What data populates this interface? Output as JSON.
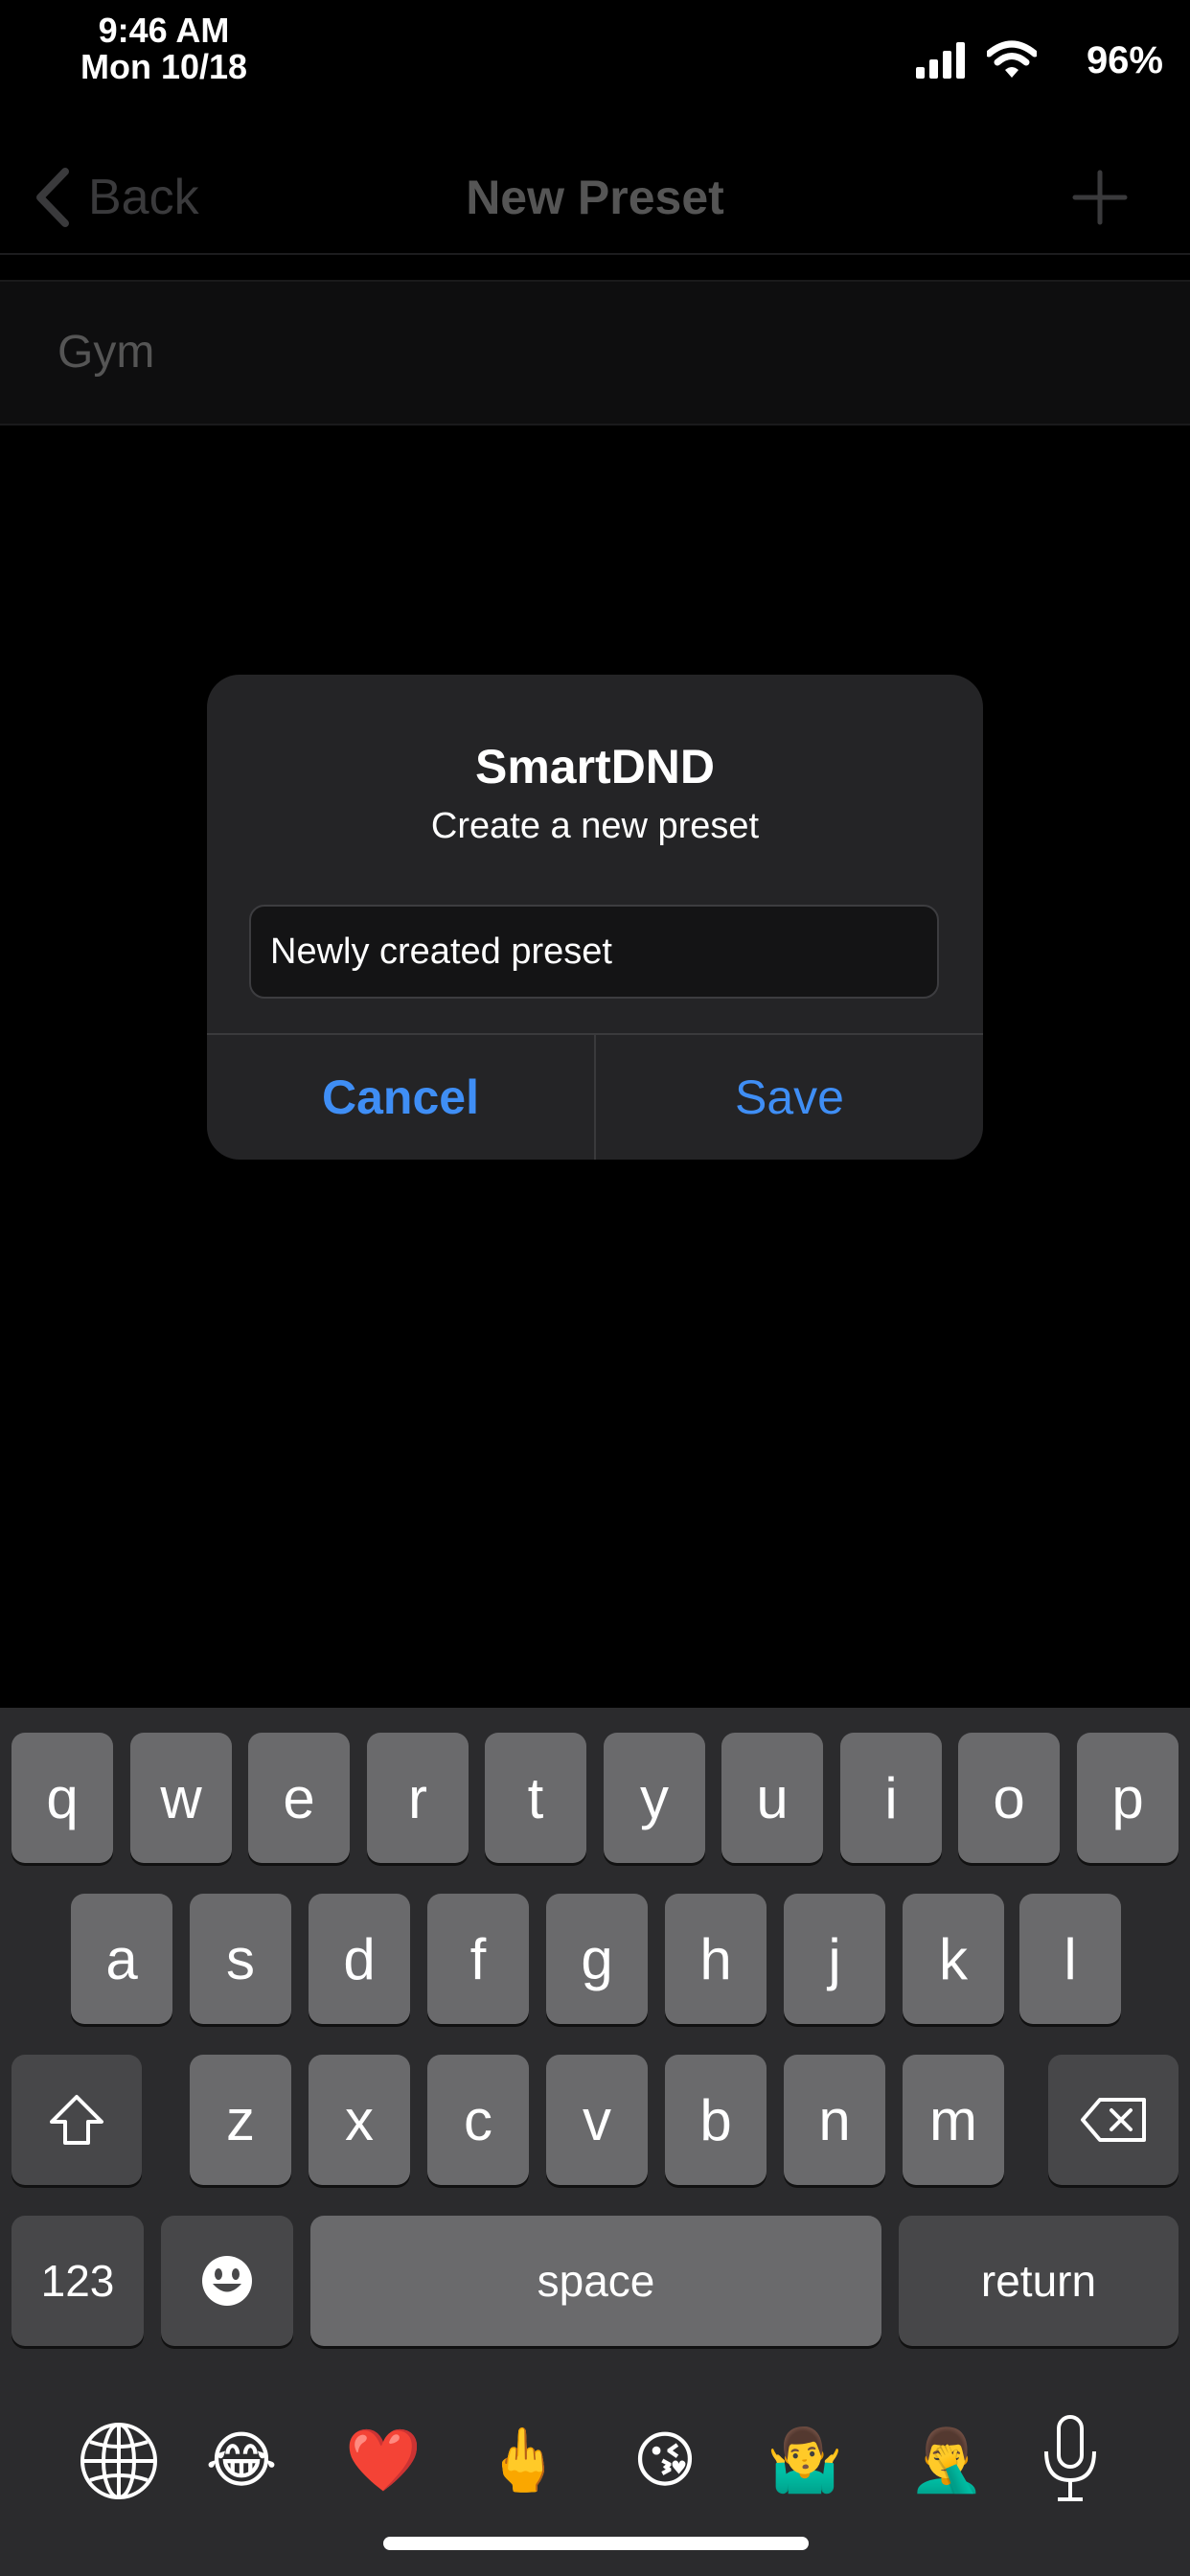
{
  "status_bar": {
    "time": "9:46 AM",
    "date": "Mon 10/18",
    "battery": "96%"
  },
  "nav": {
    "back_label": "Back",
    "title": "New Preset",
    "add_icon": "plus-icon"
  },
  "list": {
    "item_label": "Gym"
  },
  "alert": {
    "title": "SmartDND",
    "message": "Create a new preset",
    "input_value": "Newly created preset",
    "cancel_label": "Cancel",
    "save_label": "Save",
    "accent_color": "#3F8EF5"
  },
  "keyboard": {
    "row1": [
      "q",
      "w",
      "e",
      "r",
      "t",
      "y",
      "u",
      "i",
      "o",
      "p"
    ],
    "row2": [
      "a",
      "s",
      "d",
      "f",
      "g",
      "h",
      "j",
      "k",
      "l"
    ],
    "row3": [
      "z",
      "x",
      "c",
      "v",
      "b",
      "n",
      "m"
    ],
    "numbers_label": "123",
    "space_label": "space",
    "return_label": "return",
    "emoji_bar": [
      "😂",
      "❤️",
      "🖕",
      "😘",
      "🤷‍♂️",
      "🤦‍♂️"
    ]
  }
}
